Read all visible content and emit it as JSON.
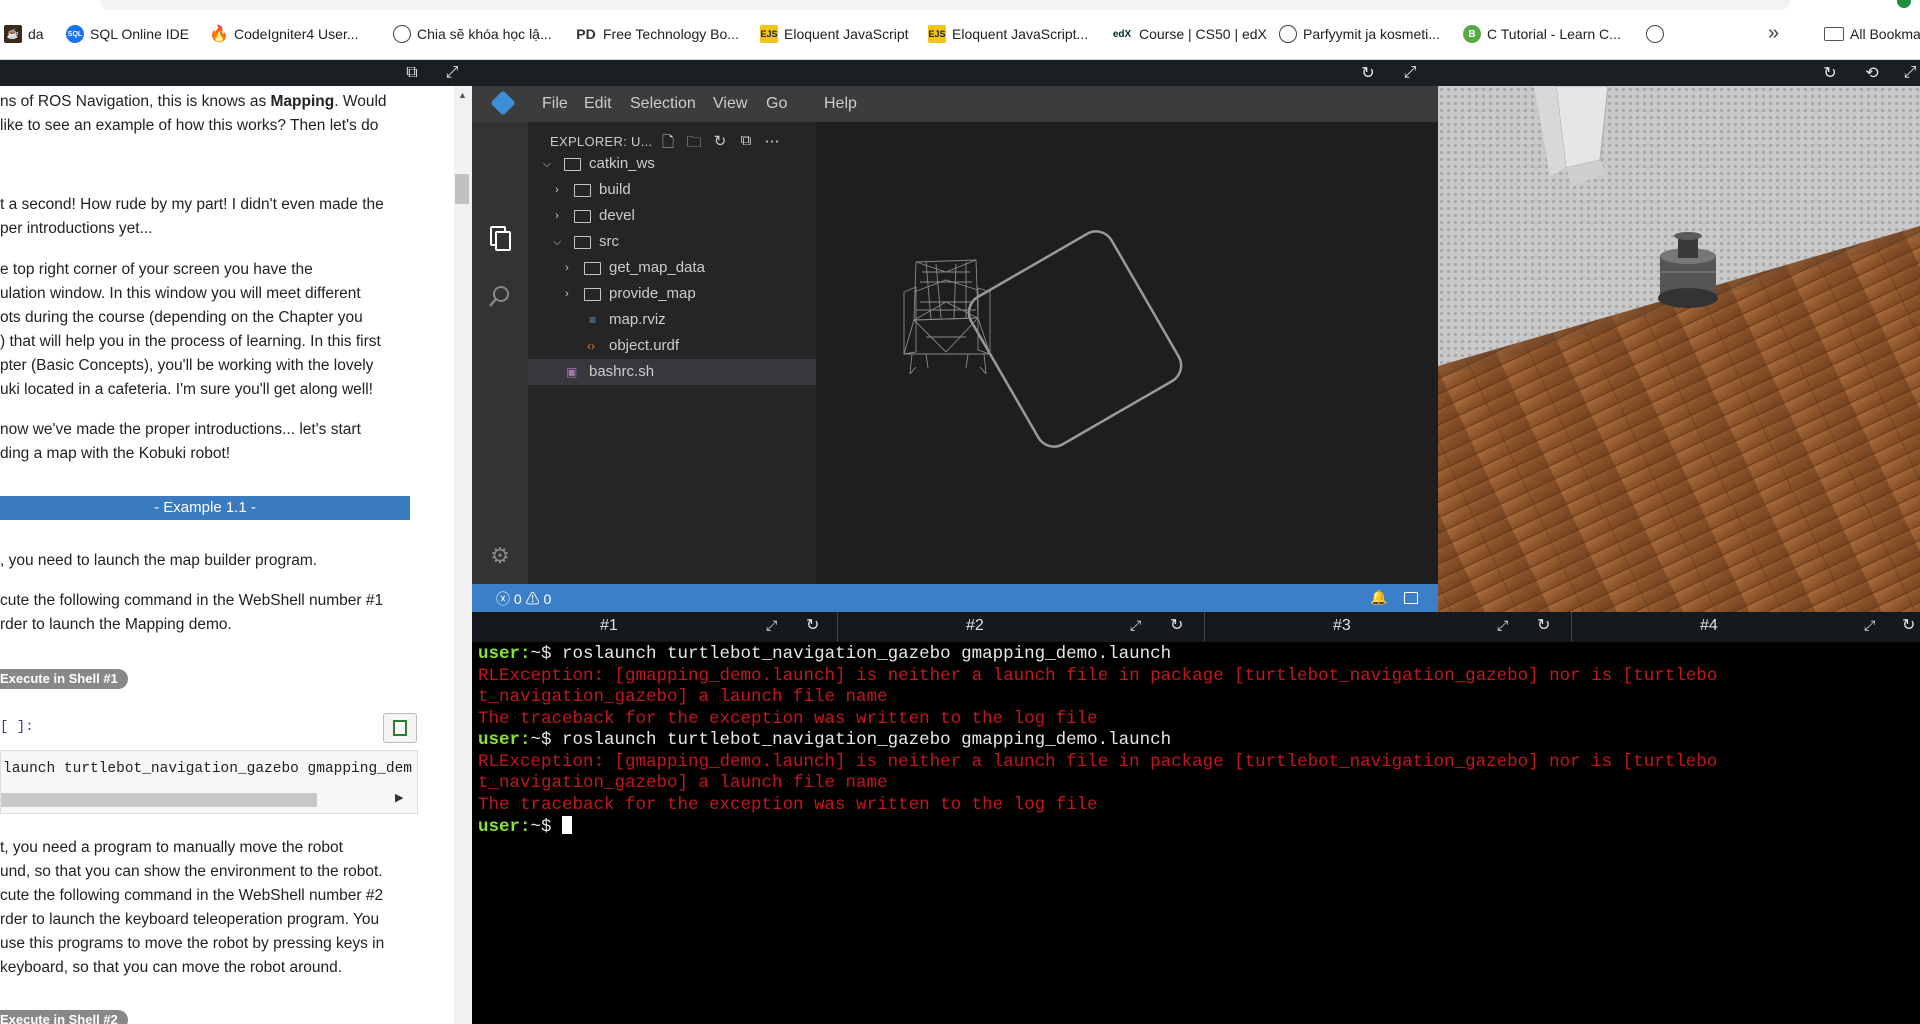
{
  "bookmarks": {
    "items": [
      {
        "label": "da",
        "icon": "coffee-icon",
        "color": "#3a2a1a"
      },
      {
        "label": "SQL Online IDE",
        "icon": "sql-icon",
        "color": "#1a73e8"
      },
      {
        "label": "CodeIgniter4 User...",
        "icon": "flame-icon",
        "color": "#ee4323"
      },
      {
        "label": "Chia sẽ khóa học lậ...",
        "icon": "globe-icon",
        "color": "#555555"
      },
      {
        "label": "Free Technology Bo...",
        "icon": "pd-icon",
        "color": "#333333"
      },
      {
        "label": "Eloquent JavaScript",
        "icon": "ejs-icon",
        "color": "#f0c419"
      },
      {
        "label": "Eloquent JavaScript...",
        "icon": "ejs-icon",
        "color": "#f0c419"
      },
      {
        "label": "Course | CS50 | edX",
        "icon": "edx-icon",
        "color": "#02262b"
      },
      {
        "label": "Parfyymit ja kosmeti...",
        "icon": "parfyymit-icon",
        "color": "#555555"
      },
      {
        "label": "C Tutorial - Learn C...",
        "icon": "b-icon",
        "color": "#58a845"
      },
      {
        "label": "",
        "icon": "globe-icon",
        "color": "#555555"
      }
    ],
    "overflow": "»",
    "all_bookmarks": "All Bookma"
  },
  "tutorial": {
    "paragraphs": [
      {
        "text_before": "ns of ROS Navigation, this is knows as ",
        "bold": "Mapping",
        "text_after": ". Would"
      },
      {
        "text": "like to see an example of how this works? Then let's do"
      },
      {
        "text": "t a second! How rude by my part! I didn't even made the"
      },
      {
        "text": "per introductions yet..."
      },
      {
        "text": "e top right corner of your screen you have the"
      },
      {
        "text": "ulation window. In this window you will meet different"
      },
      {
        "text": "ots during the course (depending on the Chapter you"
      },
      {
        "text": ") that will help you in the process of learning. In this first"
      },
      {
        "text": "pter (Basic Concepts), you'll be working with the lovely"
      },
      {
        "text": "uki located in a cafeteria. I'm sure you'll get along well!"
      },
      {
        "text": "now we've made the proper introductions... let's start"
      },
      {
        "text": "ding a map with the Kobuki robot!"
      }
    ],
    "example_title": "- Example 1.1 -",
    "step1": ", you need to launch the map builder program.",
    "step2a": "cute the following command in the WebShell number #1",
    "step2b": "rder to launch the Mapping demo.",
    "exec1": "Execute in Shell #1",
    "cell_prompt": "[ ]:",
    "code": "launch turtlebot_navigation_gazebo gmapping_demo.launch",
    "step3": [
      "t, you need a program to manually move the robot",
      "und, so that you can show the environment to the robot.",
      "cute the following command in the WebShell number #2",
      "rder to launch the keyboard teleoperation program. You",
      "use this programs to move the robot by pressing keys in",
      "keyboard, so that you can move the robot around."
    ],
    "exec2": "Execute in Shell #2"
  },
  "vscode": {
    "menu": [
      "File",
      "Edit",
      "Selection",
      "View",
      "Go",
      "Help"
    ],
    "explorer_title": "EXPLORER: U...",
    "tree": [
      {
        "label": "catkin_ws",
        "type": "folder",
        "depth": 0,
        "open": true
      },
      {
        "label": "build",
        "type": "folder",
        "depth": 1,
        "open": false
      },
      {
        "label": "devel",
        "type": "folder",
        "depth": 1,
        "open": false
      },
      {
        "label": "src",
        "type": "folder",
        "depth": 1,
        "open": true
      },
      {
        "label": "get_map_data",
        "type": "folder",
        "depth": 2,
        "open": false
      },
      {
        "label": "provide_map",
        "type": "folder",
        "depth": 2,
        "open": false
      },
      {
        "label": "map.rviz",
        "type": "file-rviz",
        "depth": 2
      },
      {
        "label": "object.urdf",
        "type": "file-urdf",
        "depth": 2
      },
      {
        "label": "bashrc.sh",
        "type": "file-sh",
        "depth": 0,
        "selected": true
      }
    ],
    "status": {
      "errors": "0",
      "warnings": "0"
    }
  },
  "terminal_tabs": [
    "#1",
    "#2",
    "#3",
    "#4"
  ],
  "terminal": {
    "lines": [
      {
        "kind": "prompt",
        "user": "user:",
        "path": "~$ ",
        "cmd": "roslaunch turtlebot_navigation_gazebo gmapping_demo.launch"
      },
      {
        "kind": "err",
        "text": "RLException: [gmapping_demo.launch] is neither a launch file in package [turtlebot_navigation_gazebo] nor is [turtlebo"
      },
      {
        "kind": "err",
        "text": "t_navigation_gazebo] a launch file name"
      },
      {
        "kind": "err",
        "text": "The traceback for the exception was written to the log file"
      },
      {
        "kind": "prompt",
        "user": "user:",
        "path": "~$ ",
        "cmd": "roslaunch turtlebot_navigation_gazebo gmapping_demo.launch"
      },
      {
        "kind": "err",
        "text": "RLException: [gmapping_demo.launch] is neither a launch file in package [turtlebot_navigation_gazebo] nor is [turtlebo"
      },
      {
        "kind": "err",
        "text": "t_navigation_gazebo] a launch file name"
      },
      {
        "kind": "err",
        "text": "The traceback for the exception was written to the log file"
      },
      {
        "kind": "prompt",
        "user": "user:",
        "path": "~$ ",
        "cmd": ""
      }
    ]
  },
  "colors": {
    "accent_blue": "#3c7fc9",
    "terminal_user": "#8ae234",
    "terminal_error": "#c4161c",
    "example_bar": "#3a7bbf"
  }
}
